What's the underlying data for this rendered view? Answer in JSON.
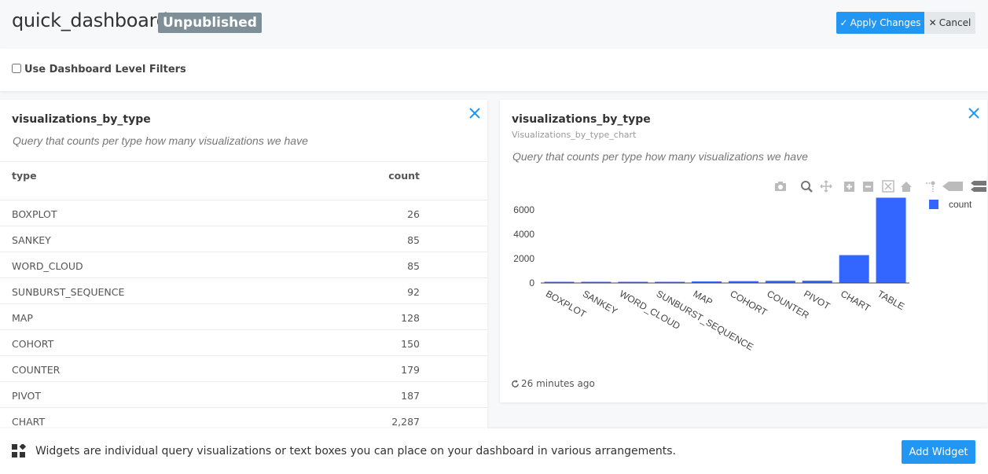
{
  "header": {
    "title": "quick_dashboard",
    "badge": "Unpublished",
    "apply_label": "Apply Changes",
    "cancel_label": "Cancel"
  },
  "filters": {
    "label": "Use Dashboard Level Filters",
    "checked": false
  },
  "table_widget": {
    "title": "visualizations_by_type",
    "description": "Query that counts per type how many visualizations we have",
    "columns": [
      "type",
      "count"
    ],
    "rows": [
      {
        "type": "BOXPLOT",
        "count": "26"
      },
      {
        "type": "SANKEY",
        "count": "85"
      },
      {
        "type": "WORD_CLOUD",
        "count": "85"
      },
      {
        "type": "SUNBURST_SEQUENCE",
        "count": "92"
      },
      {
        "type": "MAP",
        "count": "128"
      },
      {
        "type": "COHORT",
        "count": "150"
      },
      {
        "type": "COUNTER",
        "count": "179"
      },
      {
        "type": "PIVOT",
        "count": "187"
      },
      {
        "type": "CHART",
        "count": "2,287"
      }
    ]
  },
  "chart_widget": {
    "title": "visualizations_by_type",
    "subtitle": "Visualizations_by_type_chart",
    "description": "Query that counts per type how many visualizations we have",
    "refreshed": "26 minutes ago"
  },
  "chart_data": {
    "type": "bar",
    "categories": [
      "BOXPLOT",
      "SANKEY",
      "WORD_CLOUD",
      "SUNBURST_SEQUENCE",
      "MAP",
      "COHORT",
      "COUNTER",
      "PIVOT",
      "CHART",
      "TABLE"
    ],
    "series": [
      {
        "name": "count",
        "values": [
          26,
          85,
          85,
          92,
          128,
          150,
          179,
          187,
          2287,
          7000
        ],
        "color": "#3366ff"
      }
    ],
    "yticks": [
      0,
      2000,
      4000,
      6000
    ],
    "ylim": [
      0,
      7000
    ],
    "legend_position": "top-right",
    "grid": false
  },
  "bottom": {
    "text": "Widgets are individual query visualizations or text boxes you can place on your dashboard in various arrangements.",
    "add_label": "Add Widget"
  },
  "colors": {
    "primary": "#2196f3",
    "badge": "#7e8f98",
    "close": "#2196f3",
    "bar": "#3366ff"
  }
}
